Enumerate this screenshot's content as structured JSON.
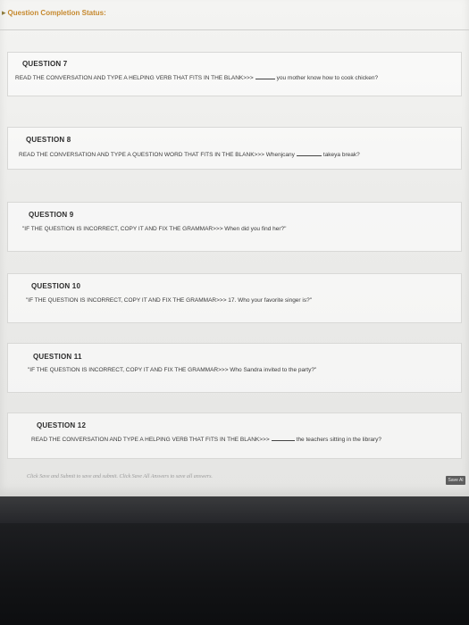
{
  "status": {
    "label": "Question Completion Status:"
  },
  "questions": [
    {
      "title": "QUESTION 7",
      "prompt_before": "READ THE CONVERSATION AND TYPE A HELPING VERB THAT FITS IN THE BLANK>>>",
      "prompt_after": "you mother know how to cook chicken?",
      "answer": ""
    },
    {
      "title": "QUESTION 8",
      "prompt_before": "READ THE CONVERSATION AND TYPE A QUESTION WORD THAT FITS IN THE BLANK>>> Whenjcany",
      "prompt_after": "takeya break?",
      "answer": ""
    },
    {
      "title": "QUESTION 9",
      "prompt": "\"IF THE QUESTION IS INCORRECT, COPY IT AND FIX THE GRAMMAR>>> When did you find her?\""
    },
    {
      "title": "QUESTION 10",
      "prompt": "\"IF THE QUESTION IS INCORRECT, COPY IT AND FIX THE GRAMMAR>>> 17. Who your favorite singer is?\""
    },
    {
      "title": "QUESTION 11",
      "prompt": "\"IF THE QUESTION IS INCORRECT, COPY IT AND FIX THE GRAMMAR>>> Who Sandra invited to the party?\""
    },
    {
      "title": "QUESTION 12",
      "prompt_before": "READ THE CONVERSATION AND TYPE A HELPING VERB THAT FITS IN THE BLANK>>>",
      "prompt_after": "the teachers sitting in the library?"
    }
  ],
  "footer": {
    "note": "Click Save and Submit to save and submit. Click Save All Answers to save all answers.",
    "save_all_label": "Save Al"
  }
}
